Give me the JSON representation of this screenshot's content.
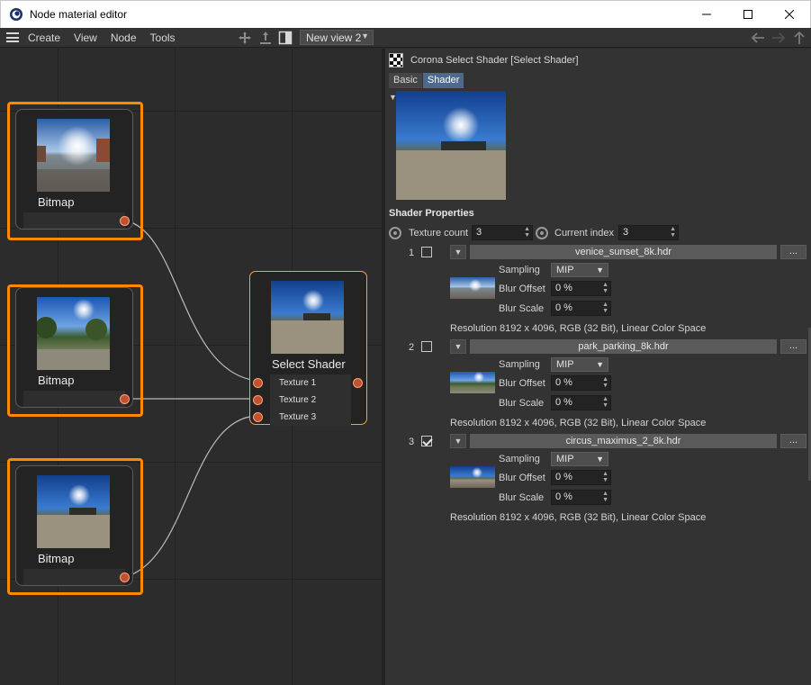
{
  "window": {
    "title": "Node material editor",
    "minimize": "—",
    "maximize": "☐",
    "close": "✕"
  },
  "menu": {
    "items": [
      "Create",
      "View",
      "Node",
      "Tools"
    ],
    "view_select": "New view 2"
  },
  "nodes": {
    "bitmap_label": "Bitmap",
    "select_title": "Select Shader",
    "inputs": [
      "Texture 1",
      "Texture 2",
      "Texture 3"
    ]
  },
  "panel": {
    "header": "Corona Select Shader [Select Shader]",
    "tabs": [
      "Basic",
      "Shader"
    ],
    "section": "Shader Properties",
    "texture_count_label": "Texture count",
    "texture_count": "3",
    "current_index_label": "Current index",
    "current_index": "3",
    "sampling_label": "Sampling",
    "blur_offset_label": "Blur Offset",
    "blur_scale_label": "Blur Scale",
    "dots": "...",
    "slots": [
      {
        "index": "1",
        "checked": false,
        "file": "venice_sunset_8k.hdr",
        "sampling": "MIP",
        "blur_offset": "0 %",
        "blur_scale": "0 %",
        "resolution": "Resolution 8192 x 4096, RGB (32 Bit), Linear Color Space"
      },
      {
        "index": "2",
        "checked": false,
        "file": "park_parking_8k.hdr",
        "sampling": "MIP",
        "blur_offset": "0 %",
        "blur_scale": "0 %",
        "resolution": "Resolution 8192 x 4096, RGB (32 Bit), Linear Color Space"
      },
      {
        "index": "3",
        "checked": true,
        "file": "circus_maximus_2_8k.hdr",
        "sampling": "MIP",
        "blur_offset": "0 %",
        "blur_scale": "0 %",
        "resolution": "Resolution 8192 x 4096, RGB (32 Bit), Linear Color Space"
      }
    ]
  },
  "colors": {
    "selection": "#ff8a00",
    "port": "#c0532f",
    "tab_active": "#4d6a8c"
  }
}
